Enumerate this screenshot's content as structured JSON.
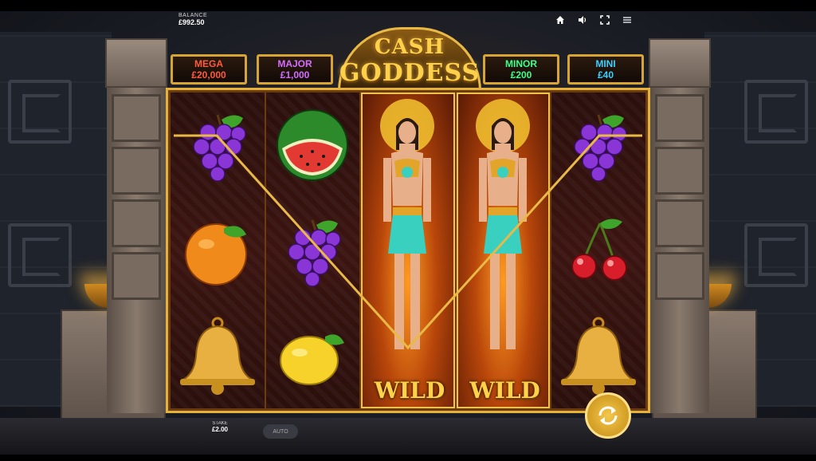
{
  "balance": {
    "label": "BALANCE",
    "value": "£992.50"
  },
  "top_icons": [
    "home-icon",
    "sound-icon",
    "fullscreen-icon",
    "menu-icon"
  ],
  "logo": {
    "line1": "CASH",
    "line2": "GODDESS"
  },
  "jackpots": [
    {
      "label": "MEGA",
      "value": "£20,000",
      "color": "#ff5a3c"
    },
    {
      "label": "MAJOR",
      "value": "£1,000",
      "color": "#d46cff"
    },
    {
      "label": "MINOR",
      "value": "£200",
      "color": "#3dff8a"
    },
    {
      "label": "MINI",
      "value": "£40",
      "color": "#3ad0ff"
    }
  ],
  "reels": [
    [
      "grapes",
      "orange",
      "bell"
    ],
    [
      "watermelon",
      "grapes",
      "lemon"
    ],
    [
      "wild",
      "wild",
      "wild"
    ],
    [
      "wild",
      "wild",
      "wild"
    ],
    [
      "grapes",
      "cherries",
      "bell"
    ]
  ],
  "wild_label": "WILD",
  "stake": {
    "label": "STAKE",
    "value": "£2.00"
  },
  "auto_label": "AUTO",
  "spin_icon": "spin-arrows-icon",
  "colors": {
    "gold": "#e4b13a",
    "reel_bg": "#3b1410",
    "payline": "#e9b948"
  }
}
